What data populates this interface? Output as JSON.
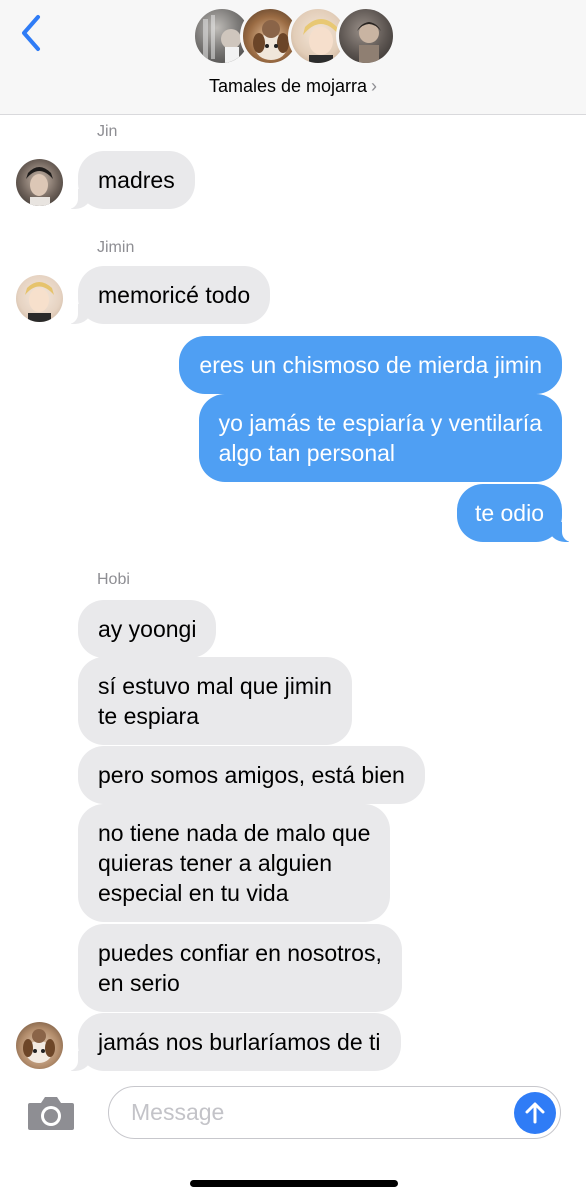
{
  "header": {
    "group_name": "Tamales de mojarra",
    "chevron": "›"
  },
  "messages": {
    "jin_sender": "Jin",
    "jin_1": "madres",
    "jimin_sender": "Jimin",
    "jimin_1": "memoricé todo",
    "me_1": "eres un chismoso de mierda jimin",
    "me_2_line1": "yo jamás te espiaría y ventilaría",
    "me_2_line2": "algo tan personal",
    "me_3": "te odio",
    "hobi_sender": "Hobi",
    "hobi_1": "ay yoongi",
    "hobi_2_line1": "sí estuvo mal que jimin",
    "hobi_2_line2": "te espiara",
    "hobi_3": "pero somos amigos, está bien",
    "hobi_4_line1": "no tiene nada de malo que",
    "hobi_4_line2": "quieras tener a alguien",
    "hobi_4_line3": "especial en tu vida",
    "hobi_5_line1": "puedes confiar en nosotros,",
    "hobi_5_line2": "en serio",
    "hobi_6": "jamás nos burlaríamos de ti"
  },
  "input": {
    "placeholder": "Message"
  },
  "colors": {
    "outgoing": "#4f9ff3",
    "incoming": "#e9e9eb",
    "send_button": "#2f7cf6",
    "back_chevron": "#2f7cf6"
  },
  "icons": {
    "back": "chevron-left-icon",
    "camera": "camera-icon",
    "send": "arrow-up-icon"
  }
}
